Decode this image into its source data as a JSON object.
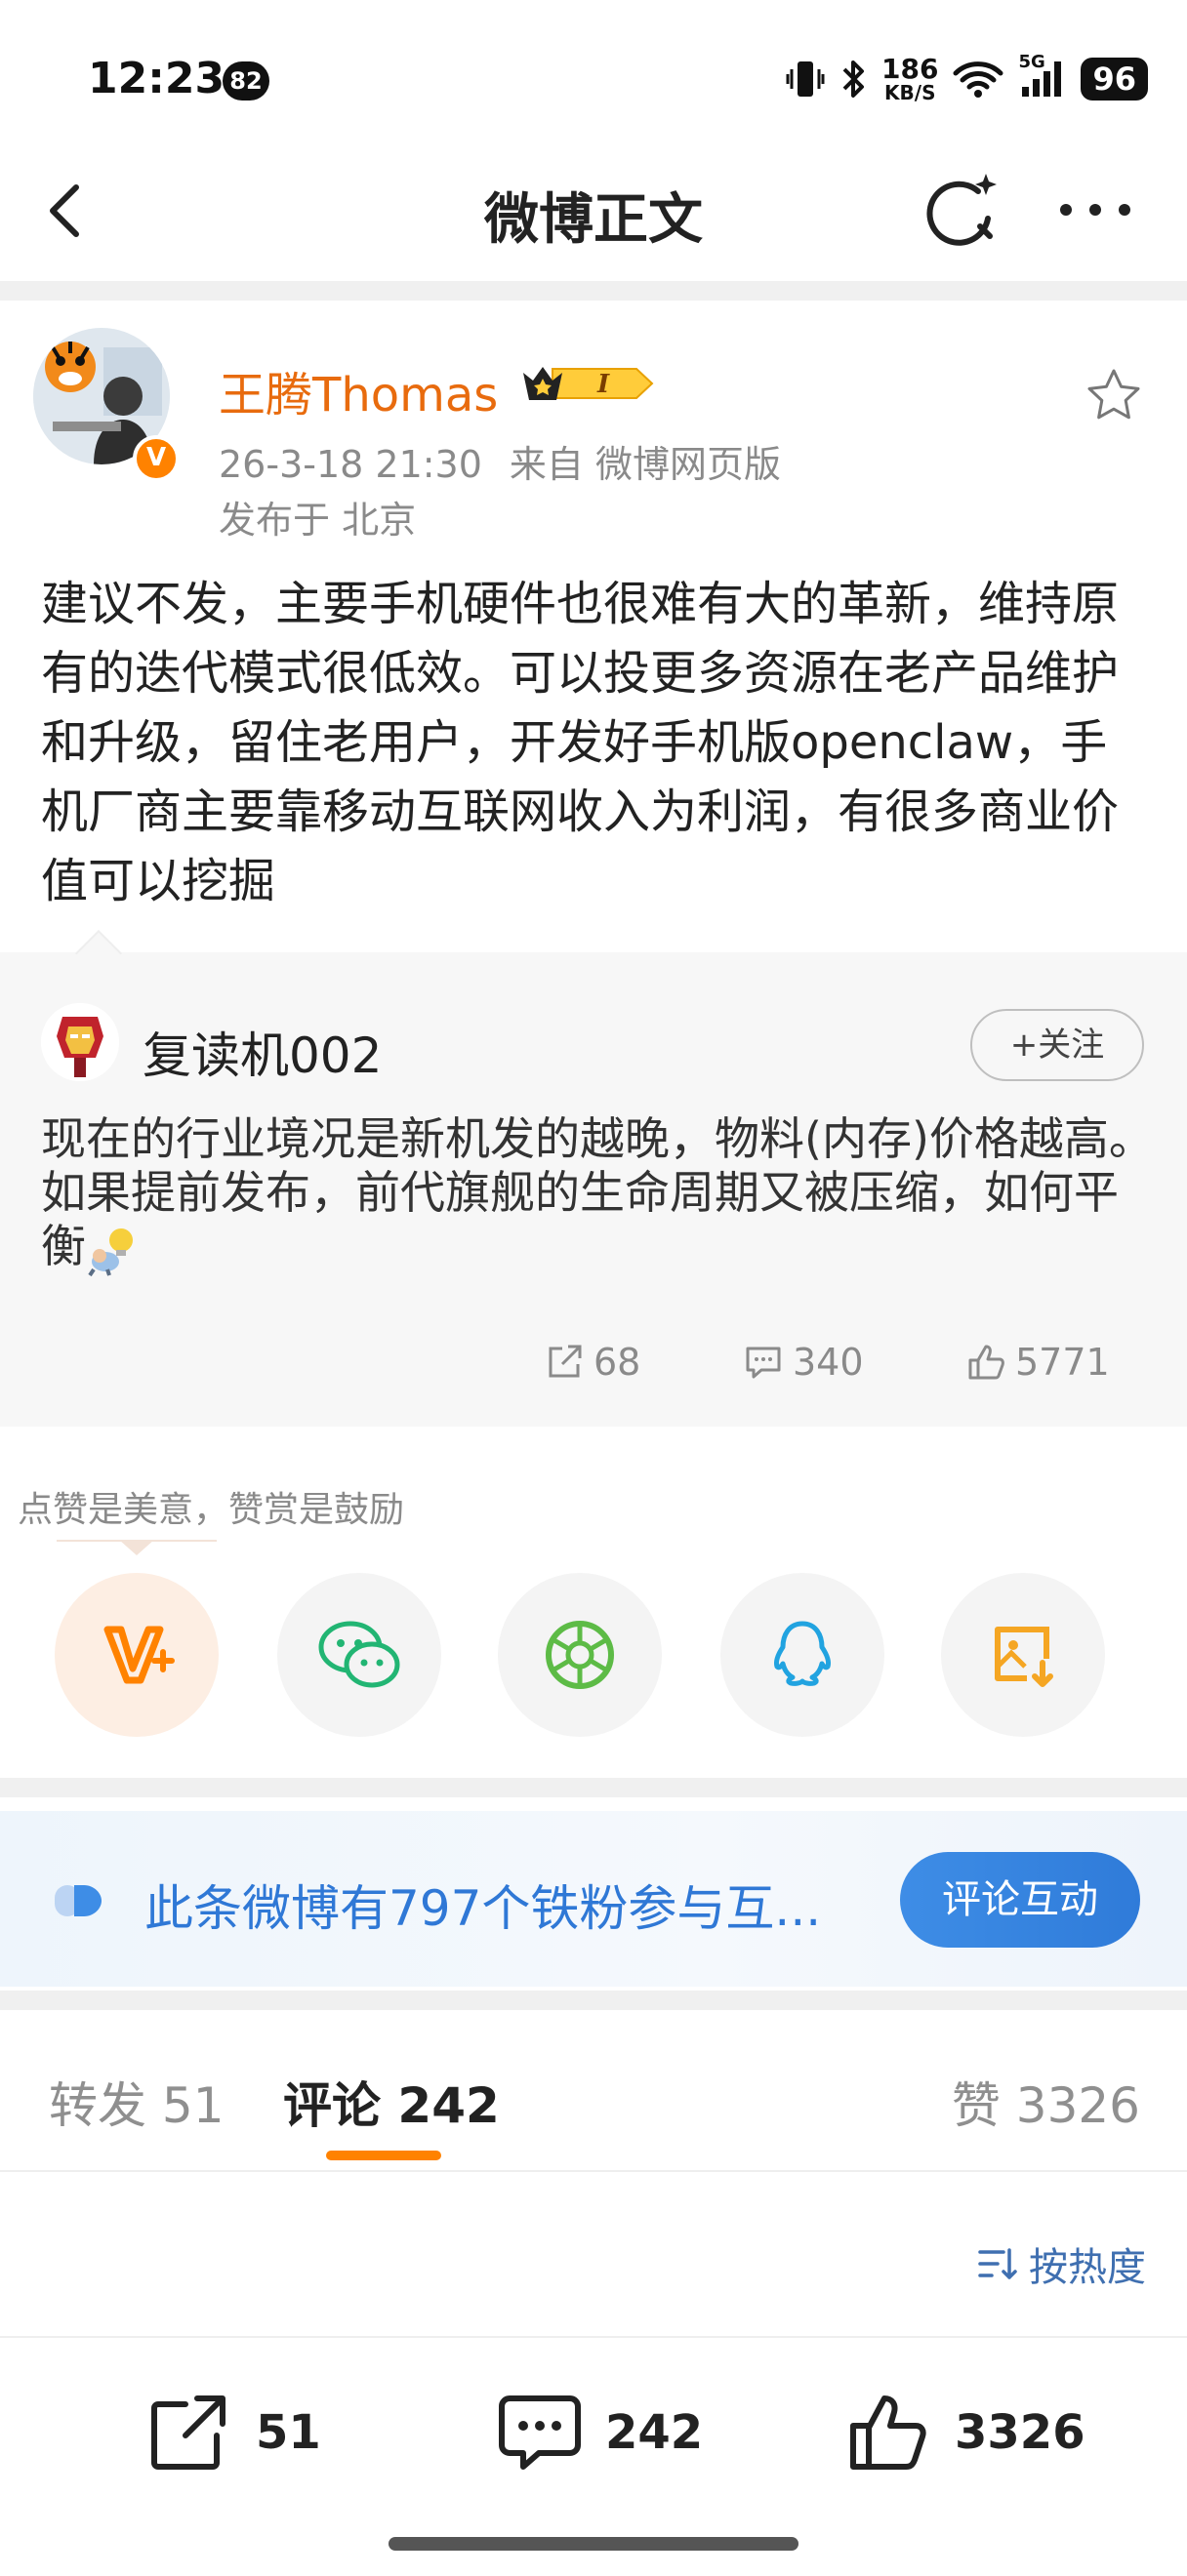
{
  "status_bar": {
    "time": "12:23",
    "notification_count": "82",
    "net_speed_value": "186",
    "net_speed_unit": "KB/S",
    "network_type": "5G",
    "battery": "96"
  },
  "nav": {
    "title": "微博正文",
    "back_icon": "chevron-left-icon",
    "refresh_icon": "refresh-sparkle-icon",
    "more_icon": "more-dots-icon"
  },
  "post": {
    "author": "王腾Thomas",
    "vip_level": "I",
    "timestamp": "26-3-18 21:30",
    "source": "来自 微博网页版",
    "location": "发布于 北京",
    "verified_mark": "V",
    "body": "建议不发，主要手机硬件也很难有大的革新，维持原有的迭代模式很低效。可以投更多资源在老产品维护和升级，留住老用户，开发好手机版openclaw，手机厂商主要靠移动互联网收入为利润，有很多商业价值可以挖掘"
  },
  "quoted_comment": {
    "user": "复读机002",
    "follow_label": "+关注",
    "text": "现在的行业境况是新机发的越晚，物料(内存)价格越高。如果提前发布，前代旗舰的生命周期又被压缩，如何平衡",
    "reposts": "68",
    "comments": "340",
    "likes": "5771"
  },
  "share": {
    "hint": "点赞是美意，赞赏是鼓励",
    "targets": [
      "weibo-vplus",
      "wechat",
      "moments",
      "qq",
      "save-image"
    ]
  },
  "banner": {
    "text": "此条微博有797个铁粉参与互...",
    "button": "评论互动"
  },
  "tabs": {
    "repost": "转发 51",
    "comment": "评论 242",
    "like": "赞 3326"
  },
  "sort_label": "按热度",
  "bottom_bar": {
    "repost_count": "51",
    "comment_count": "242",
    "like_count": "3326"
  },
  "colors": {
    "brand_orange": "#ff8200",
    "author_name": "#e86b0e",
    "link_blue": "#2f78d6"
  }
}
